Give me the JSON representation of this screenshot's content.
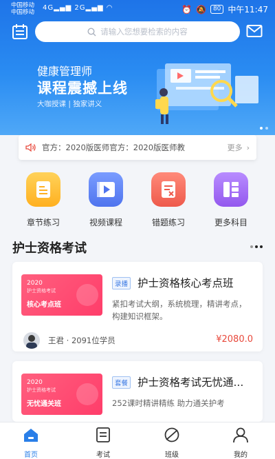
{
  "status_bar": {
    "carrier1": "中国移动",
    "carrier2": "中国移动",
    "signal1": "4G",
    "signal2": "2G",
    "battery": "80",
    "time": "中午11:47"
  },
  "search": {
    "placeholder": "请输入您想要检索的内容"
  },
  "banner": {
    "title1": "健康管理师",
    "title2": "课程震撼上线",
    "subtitle": "大咖授课 | 独家讲义"
  },
  "notice": {
    "text": "官方：2020版医师官方：2020版医师教",
    "more": "更多"
  },
  "quick_entries": [
    {
      "label": "章节练习",
      "icon": "chapter-icon",
      "color": "#ffb627"
    },
    {
      "label": "视频课程",
      "icon": "video-icon",
      "color": "#5e83f2"
    },
    {
      "label": "错题练习",
      "icon": "wrong-question-icon",
      "color": "#f26b5e"
    },
    {
      "label": "更多科目",
      "icon": "more-subjects-icon",
      "color": "#a46cf3"
    }
  ],
  "section": {
    "title": "护士资格考试"
  },
  "courses": [
    {
      "cover_year": "2020",
      "cover_sub": "护士资格考试",
      "cover_name": "核心考点班",
      "tag": "录播",
      "title": "护士资格核心考点班",
      "desc": "紧扣考试大纲，系统梳理，精讲考点，构建知识框架。",
      "teacher": "王君 · 2091位学员",
      "price": "¥2080.0"
    },
    {
      "cover_year": "2020",
      "cover_sub": "护士资格考试",
      "cover_name": "无忧通关班",
      "tag": "套餐",
      "title": "护士资格考试无忧通...",
      "desc": "252课时精讲精练  助力通关护考"
    }
  ],
  "tabs": [
    {
      "label": "首页",
      "active": true
    },
    {
      "label": "考试"
    },
    {
      "label": "班级"
    },
    {
      "label": "我的"
    }
  ]
}
